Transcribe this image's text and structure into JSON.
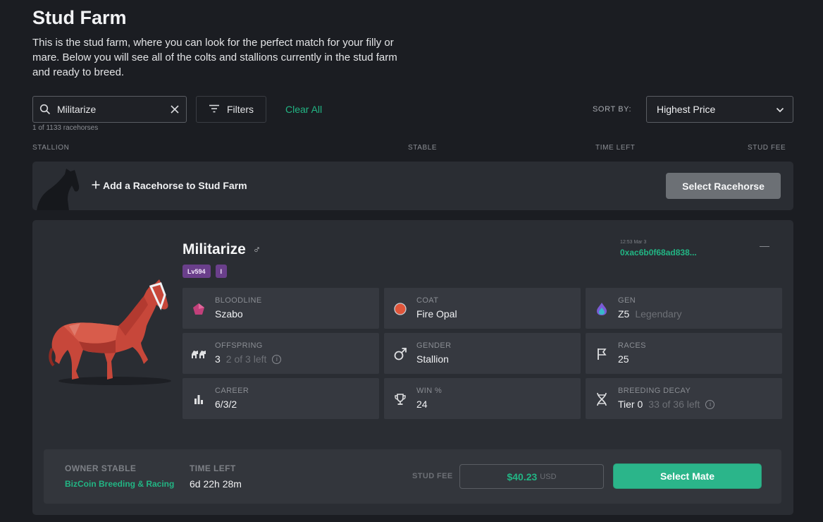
{
  "page": {
    "title": "Stud Farm",
    "intro": "This is the stud farm, where you can look for the perfect match for your filly or mare. Below you will see all of the colts and stallions currently in the stud farm and ready to breed."
  },
  "toolbar": {
    "search_value": "Militarize",
    "result_count": "1 of 1133 racehorses",
    "filters_label": "Filters",
    "clear_all_label": "Clear All",
    "sort_label": "SORT BY:",
    "sort_value": "Highest Price"
  },
  "columns": {
    "stallion": "STALLION",
    "stable": "STABLE",
    "time_left": "TIME LEFT",
    "stud_fee": "STUD FEE"
  },
  "add_row": {
    "label": "Add a Racehorse to Stud Farm",
    "button": "Select Racehorse"
  },
  "horse": {
    "name": "Militarize",
    "gender_symbol": "♂",
    "level_badge": "Lv594",
    "class_badge": "I",
    "timestamp": "12:53 Mar 3",
    "address": "0xac6b0f68ad838...",
    "coat_color": "#e0553a",
    "bloodline_color": "#c2407a",
    "stats": {
      "bloodline": {
        "label": "BLOODLINE",
        "value": "Szabo"
      },
      "coat": {
        "label": "COAT",
        "value": "Fire Opal"
      },
      "gen": {
        "label": "GEN",
        "value": "Z5",
        "sub": "Legendary"
      },
      "offspring": {
        "label": "OFFSPRING",
        "value": "3",
        "sub": "2 of 3 left"
      },
      "gender": {
        "label": "GENDER",
        "value": "Stallion"
      },
      "races": {
        "label": "RACES",
        "value": "25"
      },
      "career": {
        "label": "CAREER",
        "value": "6/3/2"
      },
      "win": {
        "label": "WIN %",
        "value": "24"
      },
      "decay": {
        "label": "BREEDING DECAY",
        "value": "Tier 0",
        "sub": "33 of 36 left"
      }
    }
  },
  "listing": {
    "owner_label": "OWNER STABLE",
    "owner_value": "BizCoin Breeding & Racing",
    "time_label": "TIME LEFT",
    "time_value": "6d 22h 28m",
    "fee_label": "STUD FEE",
    "fee_amount": "$40.23",
    "fee_currency": "USD",
    "button": "Select Mate"
  },
  "colors": {
    "accent": "#22b584",
    "badge": "#6a3f8b",
    "background": "#1b1d22",
    "card": "#2a2d33"
  }
}
